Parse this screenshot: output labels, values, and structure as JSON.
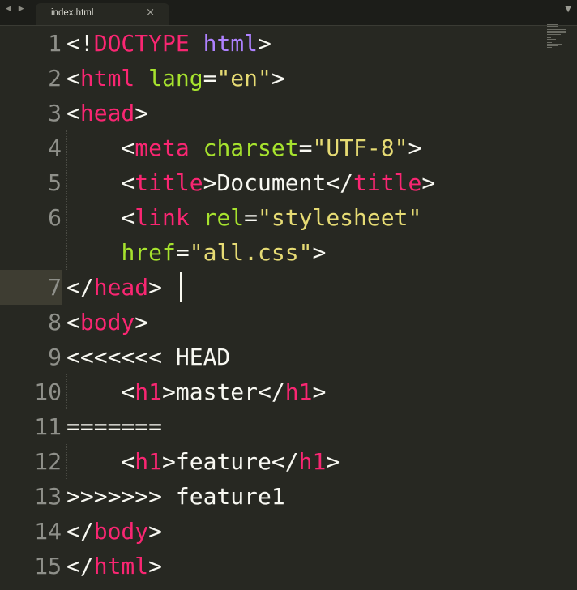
{
  "tab": {
    "title": "index.html",
    "close_icon": "×",
    "nav_icon": "◀ ▶",
    "dropdown_icon": "▼"
  },
  "editor": {
    "current_line": 7,
    "lines": [
      {
        "number": "1",
        "tokens": [
          {
            "t": "<!",
            "c": "punc"
          },
          {
            "t": "DOCTYPE",
            "c": "doctype"
          },
          {
            "t": " ",
            "c": "text"
          },
          {
            "t": "html",
            "c": "kw"
          },
          {
            "t": ">",
            "c": "punc"
          }
        ]
      },
      {
        "number": "2",
        "tokens": [
          {
            "t": "<",
            "c": "punc"
          },
          {
            "t": "html",
            "c": "tag"
          },
          {
            "t": " ",
            "c": "text"
          },
          {
            "t": "lang",
            "c": "attr"
          },
          {
            "t": "=",
            "c": "punc"
          },
          {
            "t": "\"en\"",
            "c": "str"
          },
          {
            "t": ">",
            "c": "punc"
          }
        ]
      },
      {
        "number": "3",
        "tokens": [
          {
            "t": "<",
            "c": "punc"
          },
          {
            "t": "head",
            "c": "tag"
          },
          {
            "t": ">",
            "c": "punc"
          }
        ]
      },
      {
        "number": "4",
        "tokens": [
          {
            "t": "    <",
            "c": "punc"
          },
          {
            "t": "meta",
            "c": "tag"
          },
          {
            "t": " ",
            "c": "text"
          },
          {
            "t": "charset",
            "c": "attr"
          },
          {
            "t": "=",
            "c": "punc"
          },
          {
            "t": "\"UTF-8\"",
            "c": "str"
          },
          {
            "t": ">",
            "c": "punc"
          }
        ]
      },
      {
        "number": "5",
        "tokens": [
          {
            "t": "    <",
            "c": "punc"
          },
          {
            "t": "title",
            "c": "tag"
          },
          {
            "t": ">",
            "c": "punc"
          },
          {
            "t": "Document",
            "c": "text"
          },
          {
            "t": "</",
            "c": "punc"
          },
          {
            "t": "title",
            "c": "tag"
          },
          {
            "t": ">",
            "c": "punc"
          }
        ]
      },
      {
        "number": "6",
        "tokens": [
          {
            "t": "    <",
            "c": "punc"
          },
          {
            "t": "link",
            "c": "tag"
          },
          {
            "t": " ",
            "c": "text"
          },
          {
            "t": "rel",
            "c": "attr"
          },
          {
            "t": "=",
            "c": "punc"
          },
          {
            "t": "\"stylesheet\"",
            "c": "str"
          }
        ]
      },
      {
        "number": "",
        "tokens": [
          {
            "t": "    ",
            "c": "text"
          },
          {
            "t": "href",
            "c": "attr"
          },
          {
            "t": "=",
            "c": "punc"
          },
          {
            "t": "\"all.css\"",
            "c": "str"
          },
          {
            "t": ">",
            "c": "punc"
          }
        ]
      },
      {
        "number": "7",
        "tokens": [
          {
            "t": "</",
            "c": "punc"
          },
          {
            "t": "head",
            "c": "tag"
          },
          {
            "t": ">",
            "c": "punc"
          }
        ]
      },
      {
        "number": "8",
        "tokens": [
          {
            "t": "<",
            "c": "punc"
          },
          {
            "t": "body",
            "c": "tag"
          },
          {
            "t": ">",
            "c": "punc"
          }
        ]
      },
      {
        "number": "9",
        "tokens": [
          {
            "t": "<<<<<<< HEAD",
            "c": "text"
          }
        ]
      },
      {
        "number": "10",
        "tokens": [
          {
            "t": "    <",
            "c": "punc"
          },
          {
            "t": "h1",
            "c": "tag"
          },
          {
            "t": ">",
            "c": "punc"
          },
          {
            "t": "master",
            "c": "text"
          },
          {
            "t": "</",
            "c": "punc"
          },
          {
            "t": "h1",
            "c": "tag"
          },
          {
            "t": ">",
            "c": "punc"
          }
        ]
      },
      {
        "number": "11",
        "tokens": [
          {
            "t": "=======",
            "c": "text"
          }
        ]
      },
      {
        "number": "12",
        "tokens": [
          {
            "t": "    <",
            "c": "punc"
          },
          {
            "t": "h1",
            "c": "tag"
          },
          {
            "t": ">",
            "c": "punc"
          },
          {
            "t": "feature",
            "c": "text"
          },
          {
            "t": "</",
            "c": "punc"
          },
          {
            "t": "h1",
            "c": "tag"
          },
          {
            "t": ">",
            "c": "punc"
          }
        ]
      },
      {
        "number": "13",
        "tokens": [
          {
            "t": ">>>>>>> feature1",
            "c": "text"
          }
        ]
      },
      {
        "number": "14",
        "tokens": [
          {
            "t": "</",
            "c": "punc"
          },
          {
            "t": "body",
            "c": "tag"
          },
          {
            "t": ">",
            "c": "punc"
          }
        ]
      },
      {
        "number": "15",
        "tokens": [
          {
            "t": "</",
            "c": "punc"
          },
          {
            "t": "html",
            "c": "tag"
          },
          {
            "t": ">",
            "c": "punc"
          }
        ]
      }
    ]
  },
  "theme": {
    "background": "#272822",
    "tag": "#f92672",
    "attribute": "#a6e22e",
    "string": "#e6db74",
    "keyword": "#ae81ff",
    "text": "#f8f8f2",
    "line_number": "#8f908a"
  }
}
